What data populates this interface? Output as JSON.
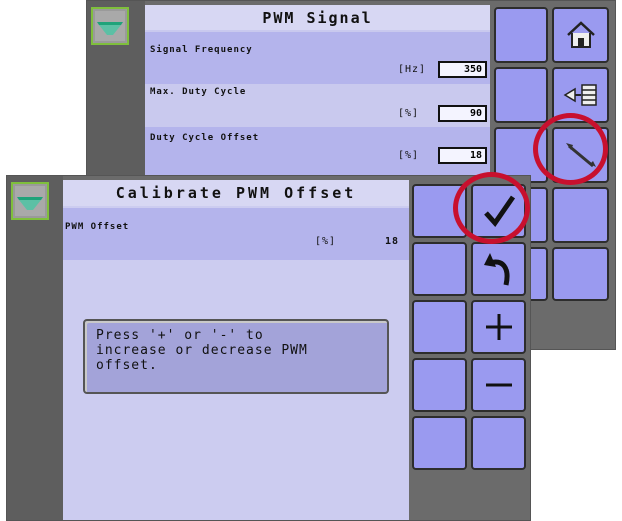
{
  "back_screen": {
    "title": "PWM Signal",
    "rows": [
      {
        "label": "Signal Frequency",
        "unit": "[Hz]",
        "value": "350"
      },
      {
        "label": "Max. Duty Cycle",
        "unit": "[%]",
        "value": "90"
      },
      {
        "label": "Duty Cycle Offset",
        "unit": "[%]",
        "value": "18"
      }
    ],
    "icons": [
      "boom-icon",
      "home-icon",
      "list-back-icon",
      "wrench-icon"
    ]
  },
  "front_screen": {
    "title": "Calibrate PWM Offset",
    "row": {
      "label": "PWM Offset",
      "unit": "[%]",
      "value": "18"
    },
    "message": "Press '+' or '-' to\nincrease or decrease PWM\noffset.",
    "icons": [
      "boom-icon",
      "checkmark-icon",
      "undo-arrow-icon",
      "plus-icon",
      "minus-icon"
    ]
  },
  "colors": {
    "highlight_circle": "#c8102e",
    "button_fill": "#9a9af0",
    "content_bg": "#ccccf0"
  }
}
